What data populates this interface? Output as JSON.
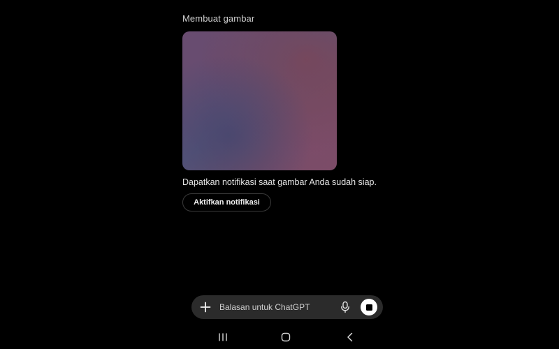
{
  "conversation": {
    "status_label": "Membuat gambar",
    "image_state": "generating-placeholder",
    "notification_prompt": "Dapatkan notifikasi saat gambar Anda sudah siap.",
    "enable_notification_button": "Aktifkan notifikasi"
  },
  "composer": {
    "placeholder": "Balasan untuk ChatGPT",
    "value": "",
    "icons": {
      "attach": "plus-icon",
      "voice": "microphone-icon",
      "stop": "stop-icon"
    }
  },
  "system_nav": {
    "icons": [
      "recent-apps-icon",
      "home-icon",
      "back-icon"
    ]
  },
  "colors": {
    "background": "#000000",
    "composer_bg": "#2b2b2b",
    "stop_button": "#ffffff"
  }
}
